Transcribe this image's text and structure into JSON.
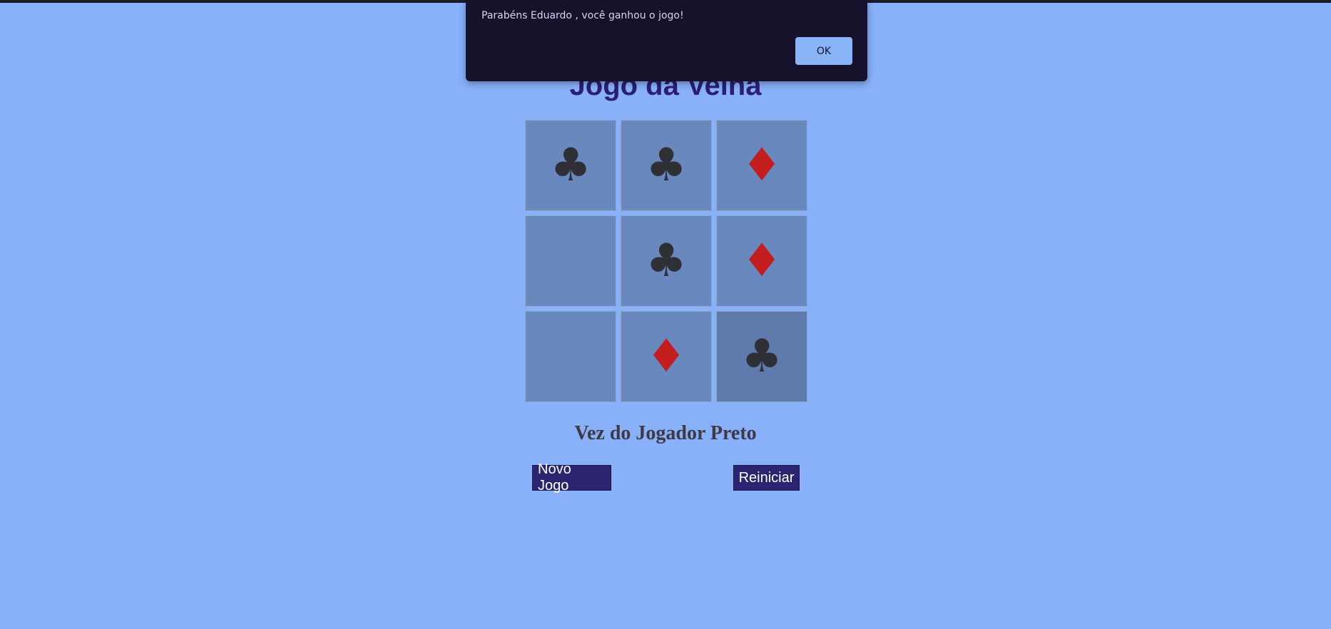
{
  "game": {
    "title": "Jogo da Velha",
    "status": "Vez do Jogador Preto",
    "board": [
      {
        "symbol": "♣",
        "color": "black"
      },
      {
        "symbol": "♣",
        "color": "black"
      },
      {
        "symbol": "♦",
        "color": "red"
      },
      {
        "symbol": "",
        "color": ""
      },
      {
        "symbol": "♣",
        "color": "black"
      },
      {
        "symbol": "♦",
        "color": "red"
      },
      {
        "symbol": "",
        "color": ""
      },
      {
        "symbol": "♦",
        "color": "red"
      },
      {
        "symbol": "♣",
        "color": "black"
      }
    ]
  },
  "buttons": {
    "new_game": "Novo Jogo",
    "restart": "Reiniciar"
  },
  "dialog": {
    "message": "Parabéns Eduardo , você ganhou o jogo!",
    "ok_label": "OK"
  },
  "colors": {
    "background": "#89b1f9",
    "cell": "#6888be",
    "title": "#2a1f72",
    "button": "#2b2571",
    "club": "#2f2f36",
    "diamond": "#c31d1d",
    "dialog": "#16122b",
    "dialog_button": "#8ab4f8"
  },
  "icons": {
    "club": "club-icon",
    "diamond": "diamond-icon"
  }
}
